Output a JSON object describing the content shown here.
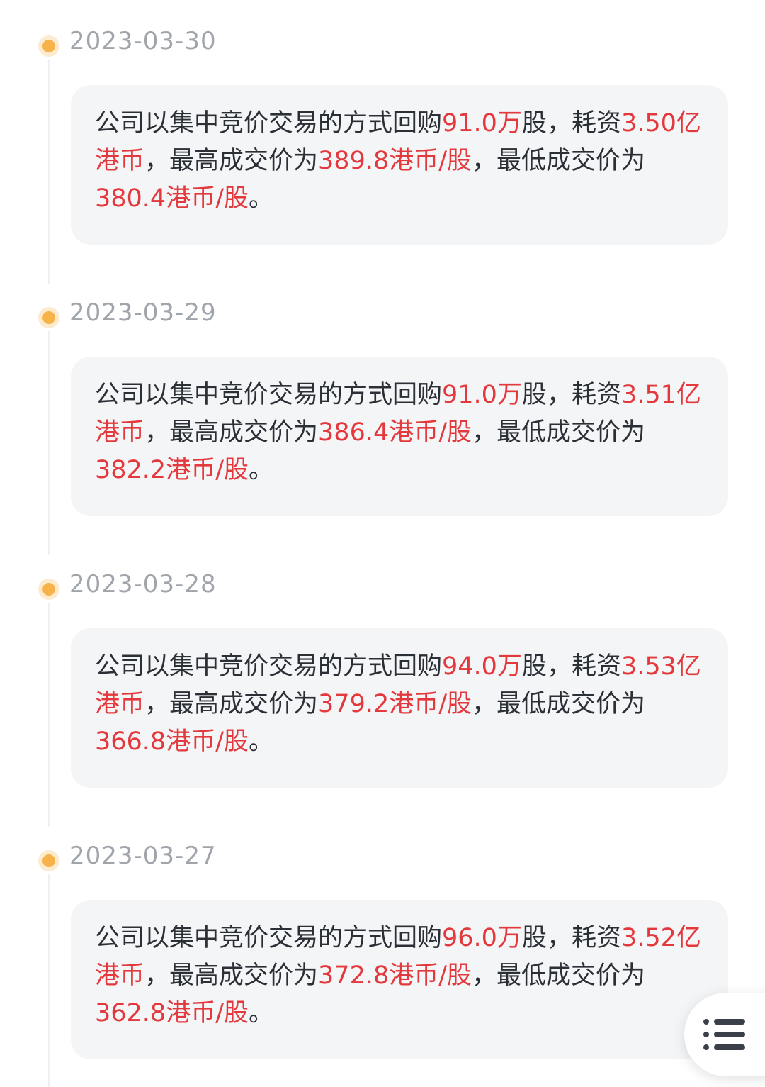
{
  "colors": {
    "highlight": "#e4393c",
    "dot": "#f7b34a",
    "date": "#a0a4ab",
    "card_bg": "#f4f5f7"
  },
  "entries": [
    {
      "date": "2023-03-30",
      "t1": "公司以集中竞价交易的方式回购",
      "shares": "91.0万",
      "t2": "股，耗资",
      "cost": "3.50亿港币",
      "t3": "，最高成交价为",
      "high": "389.8港币/股",
      "t4": "，最低成交价为",
      "low": "380.4港币/股",
      "t5": "。"
    },
    {
      "date": "2023-03-29",
      "t1": "公司以集中竞价交易的方式回购",
      "shares": "91.0万",
      "t2": "股，耗资",
      "cost": "3.51亿港币",
      "t3": "，最高成交价为",
      "high": "386.4港币/股",
      "t4": "，最低成交价为",
      "low": "382.2港币/股",
      "t5": "。"
    },
    {
      "date": "2023-03-28",
      "t1": "公司以集中竞价交易的方式回购",
      "shares": "94.0万",
      "t2": "股，耗资",
      "cost": "3.53亿港币",
      "t3": "，最高成交价为",
      "high": "379.2港币/股",
      "t4": "，最低成交价为",
      "low": "366.8港币/股",
      "t5": "。"
    },
    {
      "date": "2023-03-27",
      "t1": "公司以集中竞价交易的方式回购",
      "shares": "96.0万",
      "t2": "股，耗资",
      "cost": "3.52亿港币",
      "t3": "，最高成交价为",
      "high": "372.8港币/股",
      "t4": "，最低成交价为",
      "low": "362.8港币/股",
      "t5": "。"
    }
  ],
  "fab": {
    "icon": "list-menu-icon"
  }
}
